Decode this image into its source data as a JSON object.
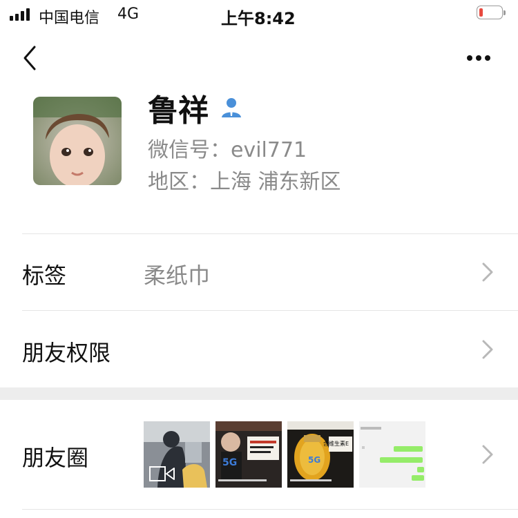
{
  "status_bar": {
    "carrier": "中国电信",
    "network": "4G",
    "time": "上午8:42",
    "battery_level": 0.18,
    "battery_color": "#e84a3f"
  },
  "nav": {
    "back_icon": "chevron-left-icon",
    "more_icon": "ellipsis-icon"
  },
  "profile": {
    "name": "鲁祥",
    "badge_icon": "person-icon",
    "badge_color": "#4a90d9",
    "wechat_id": "微信号：evil771",
    "region": "地区：上海 浦东新区"
  },
  "rows": {
    "tags": {
      "label": "标签",
      "value": "柔纸巾"
    },
    "permissions": {
      "label": "朋友权限"
    },
    "moments": {
      "label": "朋友圈"
    }
  },
  "moments_thumbnails": {
    "t2": {
      "caption": "5G"
    },
    "t3": {
      "caption": "含维生素E"
    }
  }
}
